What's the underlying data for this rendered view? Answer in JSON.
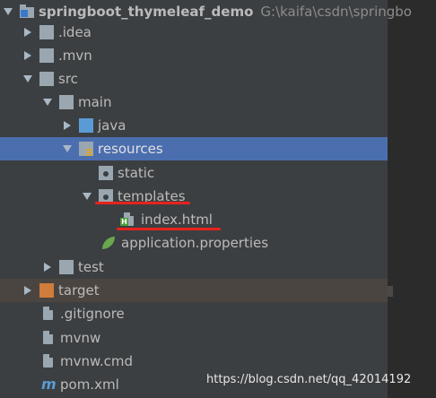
{
  "project": {
    "name": "springboot_thymeleaf_demo",
    "path": "G:\\kaifa\\csdn\\springbo"
  },
  "tree": {
    "idea": ".idea",
    "mvn": ".mvn",
    "src": "src",
    "main": "main",
    "java": "java",
    "resources": "resources",
    "static": "static",
    "templates": "templates",
    "index_html": "index.html",
    "application_properties": "application.properties",
    "test": "test",
    "target": "target",
    "gitignore": ".gitignore",
    "mvnw": "mvnw",
    "mvnw_cmd": "mvnw.cmd",
    "pom_xml": "pom.xml"
  },
  "watermark": "https://blog.csdn.net/qq_42014192",
  "colors": {
    "panel_bg": "#3c3f41",
    "selection": "#4b6eaf",
    "target_row": "#4a4540",
    "annotation_underline": "#e8231d"
  },
  "icons": {
    "project": "project-folder-icon",
    "folder": "folder-icon",
    "source_folder": "source-folder-icon",
    "resources_folder": "resources-folder-icon",
    "excluded_folder": "excluded-folder-icon",
    "html_file": "html-file-icon",
    "spring_properties": "spring-leaf-icon",
    "maven": "maven-icon",
    "file": "file-icon"
  }
}
